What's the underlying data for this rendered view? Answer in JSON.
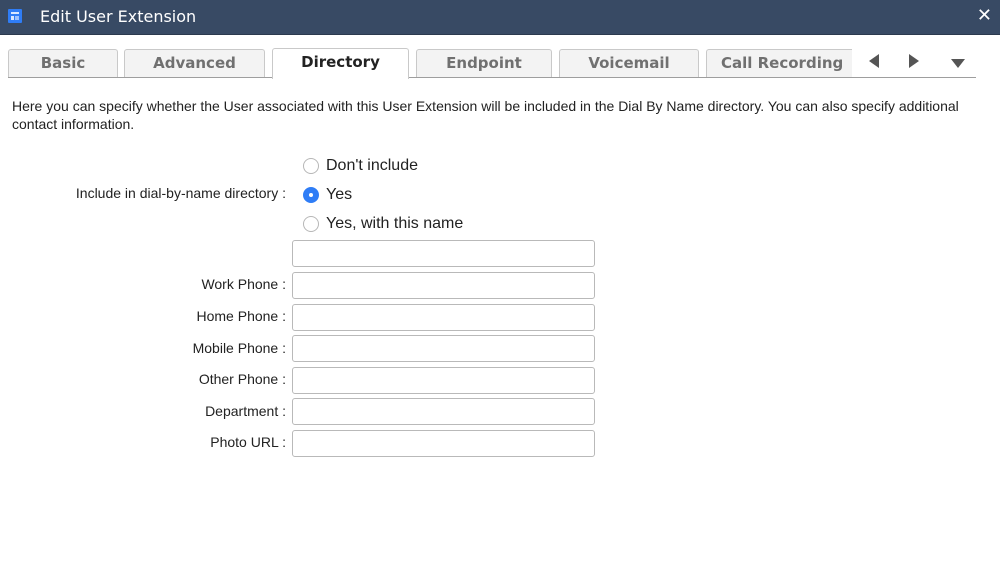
{
  "window": {
    "title": "Edit User Extension",
    "icon": "app-window-icon",
    "close_glyph": "✕"
  },
  "tabs": [
    {
      "label": "Basic",
      "active": false
    },
    {
      "label": "Advanced",
      "active": false
    },
    {
      "label": "Directory",
      "active": true
    },
    {
      "label": "Endpoint",
      "active": false
    },
    {
      "label": "Voicemail",
      "active": false
    },
    {
      "label": "Call Recording",
      "active": false
    }
  ],
  "tab_nav": {
    "prev": "triangle-left-icon",
    "next": "triangle-right-icon",
    "more": "triangle-down-icon"
  },
  "description": "Here you can specify whether the User associated with this User Extension will be included in the Dial By Name directory. You can also specify additional contact information.",
  "directory": {
    "label": "Include in dial-by-name directory :",
    "options": [
      {
        "label": "Don't include",
        "checked": false
      },
      {
        "label": "Yes",
        "checked": true
      },
      {
        "label": "Yes, with this name",
        "checked": false
      }
    ],
    "name_value": ""
  },
  "fields": [
    {
      "label": "Work Phone :",
      "value": ""
    },
    {
      "label": "Home Phone :",
      "value": ""
    },
    {
      "label": "Mobile Phone :",
      "value": ""
    },
    {
      "label": "Other Phone :",
      "value": ""
    },
    {
      "label": "Department :",
      "value": ""
    },
    {
      "label": "Photo URL :",
      "value": ""
    }
  ],
  "colors": {
    "titlebar": "#384a64",
    "accent": "#2f7df6"
  }
}
